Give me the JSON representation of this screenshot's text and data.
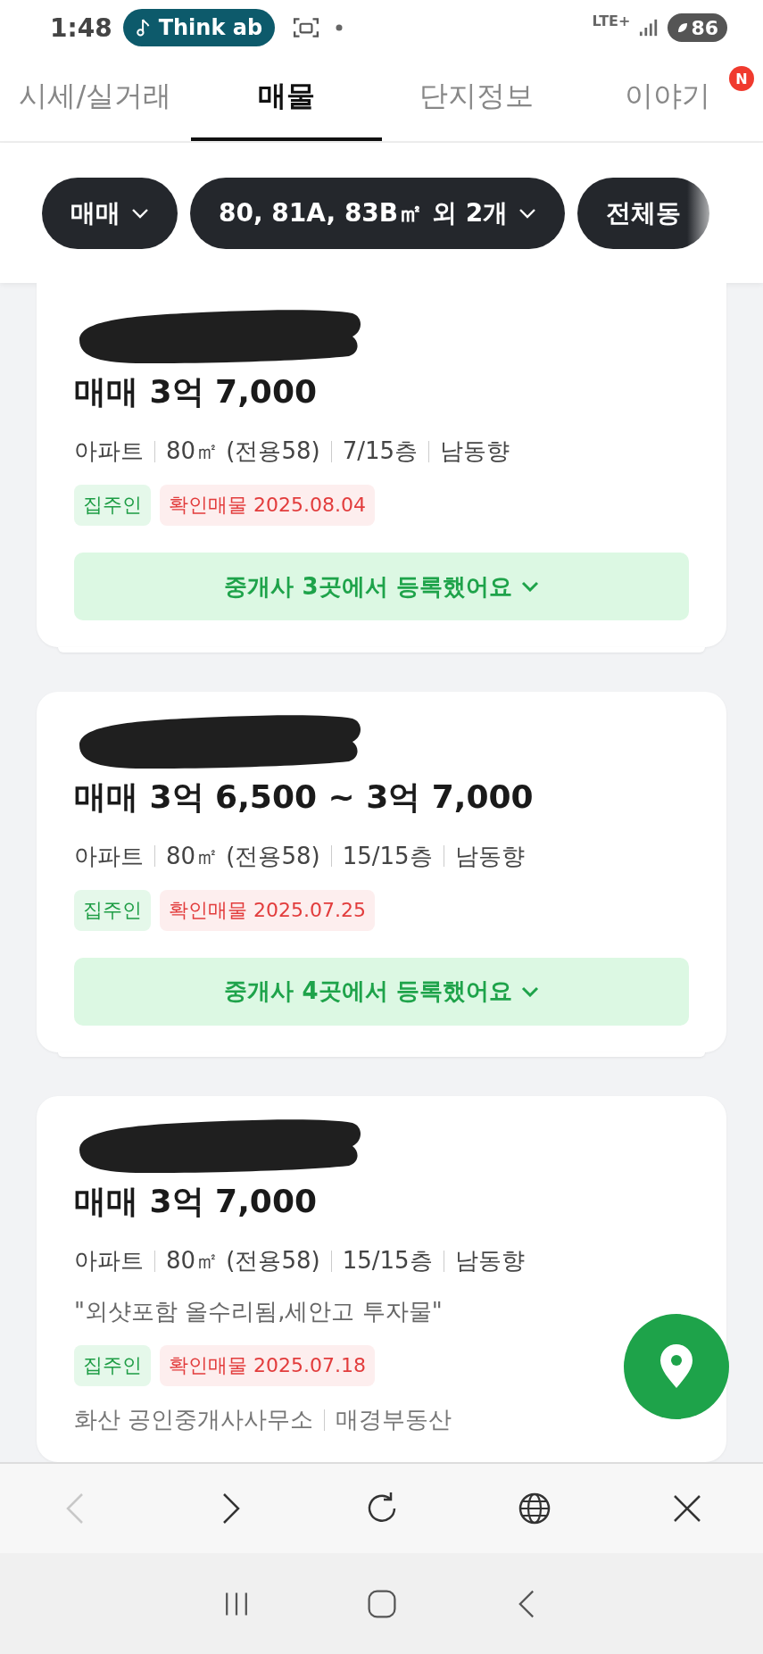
{
  "status_bar": {
    "time": "1:48",
    "media_chip": "Think ab",
    "network": "LTE+",
    "battery": "86"
  },
  "tabs": [
    {
      "label": "시세/실거래",
      "selected": false
    },
    {
      "label": "매물",
      "selected": true
    },
    {
      "label": "단지정보",
      "selected": false
    },
    {
      "label": "이야기",
      "selected": false,
      "badge": "N"
    }
  ],
  "filters": [
    {
      "label": "매매",
      "caret": true
    },
    {
      "label": "80, 81A, 83B㎡ 외 2개",
      "caret": true
    },
    {
      "label": "전체동",
      "caret": false
    }
  ],
  "listings": [
    {
      "price": "매매 3억 7,000",
      "meta": [
        "아파트",
        "80㎡ (전용58)",
        "7/15층",
        "남동향"
      ],
      "tags": [
        {
          "label": "집주인",
          "kind": "owner"
        },
        {
          "label": "확인매물 2025.08.04",
          "kind": "verified"
        }
      ],
      "brokers_button": "중개사 3곳에서 등록했어요",
      "stacked": true
    },
    {
      "price": "매매 3억 6,500 ~ 3억 7,000",
      "meta": [
        "아파트",
        "80㎡ (전용58)",
        "15/15층",
        "남동향"
      ],
      "tags": [
        {
          "label": "집주인",
          "kind": "owner"
        },
        {
          "label": "확인매물 2025.07.25",
          "kind": "verified"
        }
      ],
      "brokers_button": "중개사 4곳에서 등록했어요",
      "stacked": true
    },
    {
      "price": "매매 3억 7,000",
      "meta": [
        "아파트",
        "80㎡ (전용58)",
        "15/15층",
        "남동향"
      ],
      "note": "\"외샷포함 올수리됨,세안고 투자물\"",
      "tags": [
        {
          "label": "집주인",
          "kind": "owner"
        },
        {
          "label": "확인매물 2025.07.18",
          "kind": "verified"
        }
      ],
      "agencies": [
        "화산 공인중개사사무소",
        "매경부동산"
      ]
    }
  ],
  "browser_bar": {
    "back_disabled": true
  }
}
